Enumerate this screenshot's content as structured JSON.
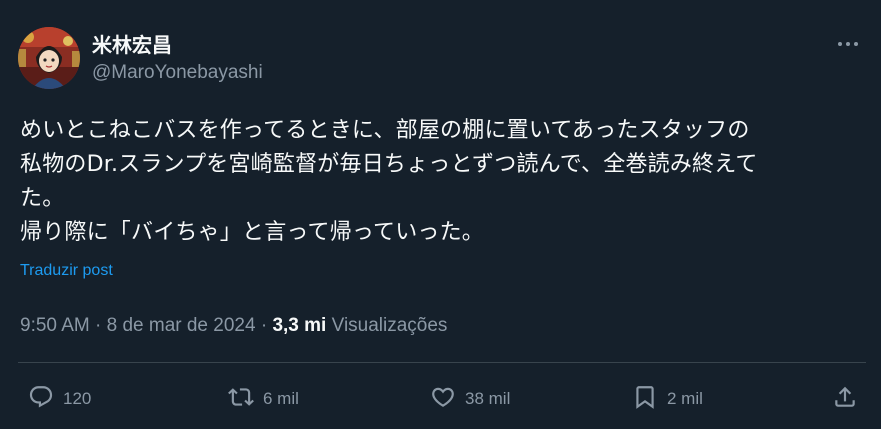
{
  "author": {
    "display_name": "米林宏昌",
    "handle": "@MaroYonebayashi"
  },
  "tweet": {
    "text": "めいとこねこバスを作ってるときに、部屋の棚に置いてあったスタッフの\n私物のDr.スランプを宮崎監督が毎日ちょっとずつ読んで、全巻読み終えて\nた。\n帰り際に「バイちゃ」と言って帰っていった。",
    "translate_label": "Traduzir post",
    "time": "9:50 AM",
    "date": "8 de mar de 2024",
    "views_count": "3,3 mi",
    "views_label": "Visualizações",
    "separator": "·"
  },
  "actions": {
    "replies": "120",
    "reposts": "6 mil",
    "likes": "38 mil",
    "bookmarks": "2 mil"
  },
  "icons": {
    "more": "more-icon",
    "reply": "reply-icon",
    "repost": "repost-icon",
    "like": "heart-icon",
    "bookmark": "bookmark-icon",
    "share": "share-icon"
  },
  "colors": {
    "background": "#15202b",
    "text_primary": "#f7f9f9",
    "text_secondary": "#8b98a5",
    "accent": "#1d9bf0",
    "divider": "#38444d"
  }
}
